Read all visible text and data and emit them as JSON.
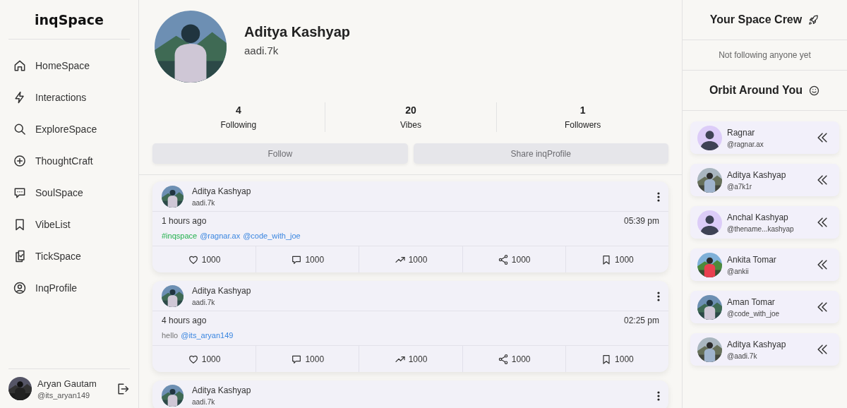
{
  "sidebar": {
    "logo": "inqSpace",
    "nav": [
      {
        "label": "HomeSpace",
        "selected": false
      },
      {
        "label": "Interactions",
        "selected": false
      },
      {
        "label": "ExploreSpace",
        "selected": false
      },
      {
        "label": "ThoughtCraft",
        "selected": false
      },
      {
        "label": "SoulSpace",
        "selected": false
      },
      {
        "label": "VibeList",
        "selected": false
      },
      {
        "label": "TickSpace",
        "selected": false
      },
      {
        "label": "InqProfile",
        "selected": false
      }
    ],
    "user": {
      "name": "Aryan Gautam",
      "handle": "@its_aryan149"
    }
  },
  "profile": {
    "name": "Aditya Kashyap",
    "handle": "aadi.7k",
    "stats": [
      {
        "count": "4",
        "label": "Following"
      },
      {
        "count": "20",
        "label": "Vibes"
      },
      {
        "count": "1",
        "label": "Followers"
      }
    ],
    "buttons": [
      "Follow",
      "Share inqProfile"
    ]
  },
  "posts": [
    {
      "author": "Aditya Kashyap",
      "handle": "aadi.7k",
      "ago": "1 hours ago",
      "time": "05:39 pm",
      "body": [
        {
          "kind": "hashtag",
          "text": "#inqspace"
        },
        {
          "kind": "mention",
          "text": "@ragnar.ax"
        },
        {
          "kind": "mention",
          "text": "@code_with_joe"
        }
      ],
      "actions": [
        {
          "kind": "like",
          "count": "1000"
        },
        {
          "kind": "comment",
          "count": "1000"
        },
        {
          "kind": "boost",
          "count": "1000"
        },
        {
          "kind": "share",
          "count": "1000"
        },
        {
          "kind": "save",
          "count": "1000"
        }
      ]
    },
    {
      "author": "Aditya Kashyap",
      "handle": "aadi.7k",
      "ago": "4 hours ago",
      "time": "02:25 pm",
      "body": [
        {
          "kind": "plain",
          "text": "hello"
        },
        {
          "kind": "mention",
          "text": "@its_aryan149"
        }
      ],
      "actions": [
        {
          "kind": "like",
          "count": "1000"
        },
        {
          "kind": "comment",
          "count": "1000"
        },
        {
          "kind": "boost",
          "count": "1000"
        },
        {
          "kind": "share",
          "count": "1000"
        },
        {
          "kind": "save",
          "count": "1000"
        }
      ]
    },
    {
      "author": "Aditya Kashyap",
      "handle": "aadi.7k"
    }
  ],
  "crew": {
    "title": "Your Space Crew",
    "empty": "Not following anyone yet"
  },
  "orbit": {
    "title": "Orbit Around You",
    "people": [
      {
        "name": "Ragnar",
        "handle": "@ragnar.ax",
        "kind": "placeholder"
      },
      {
        "name": "Aditya Kashyap",
        "handle": "@a7k1r",
        "kind": "picture"
      },
      {
        "name": "Anchal Kashyap",
        "handle": "@thename...kashyap",
        "kind": "placeholder"
      },
      {
        "name": "Ankita Tomar",
        "handle": "@ankii",
        "kind": "picture"
      },
      {
        "name": "Aman Tomar",
        "handle": "@code_with_joe",
        "kind": "picture"
      },
      {
        "name": "Aditya Kashyap",
        "handle": "@aadi.7k",
        "kind": "picture"
      }
    ]
  }
}
